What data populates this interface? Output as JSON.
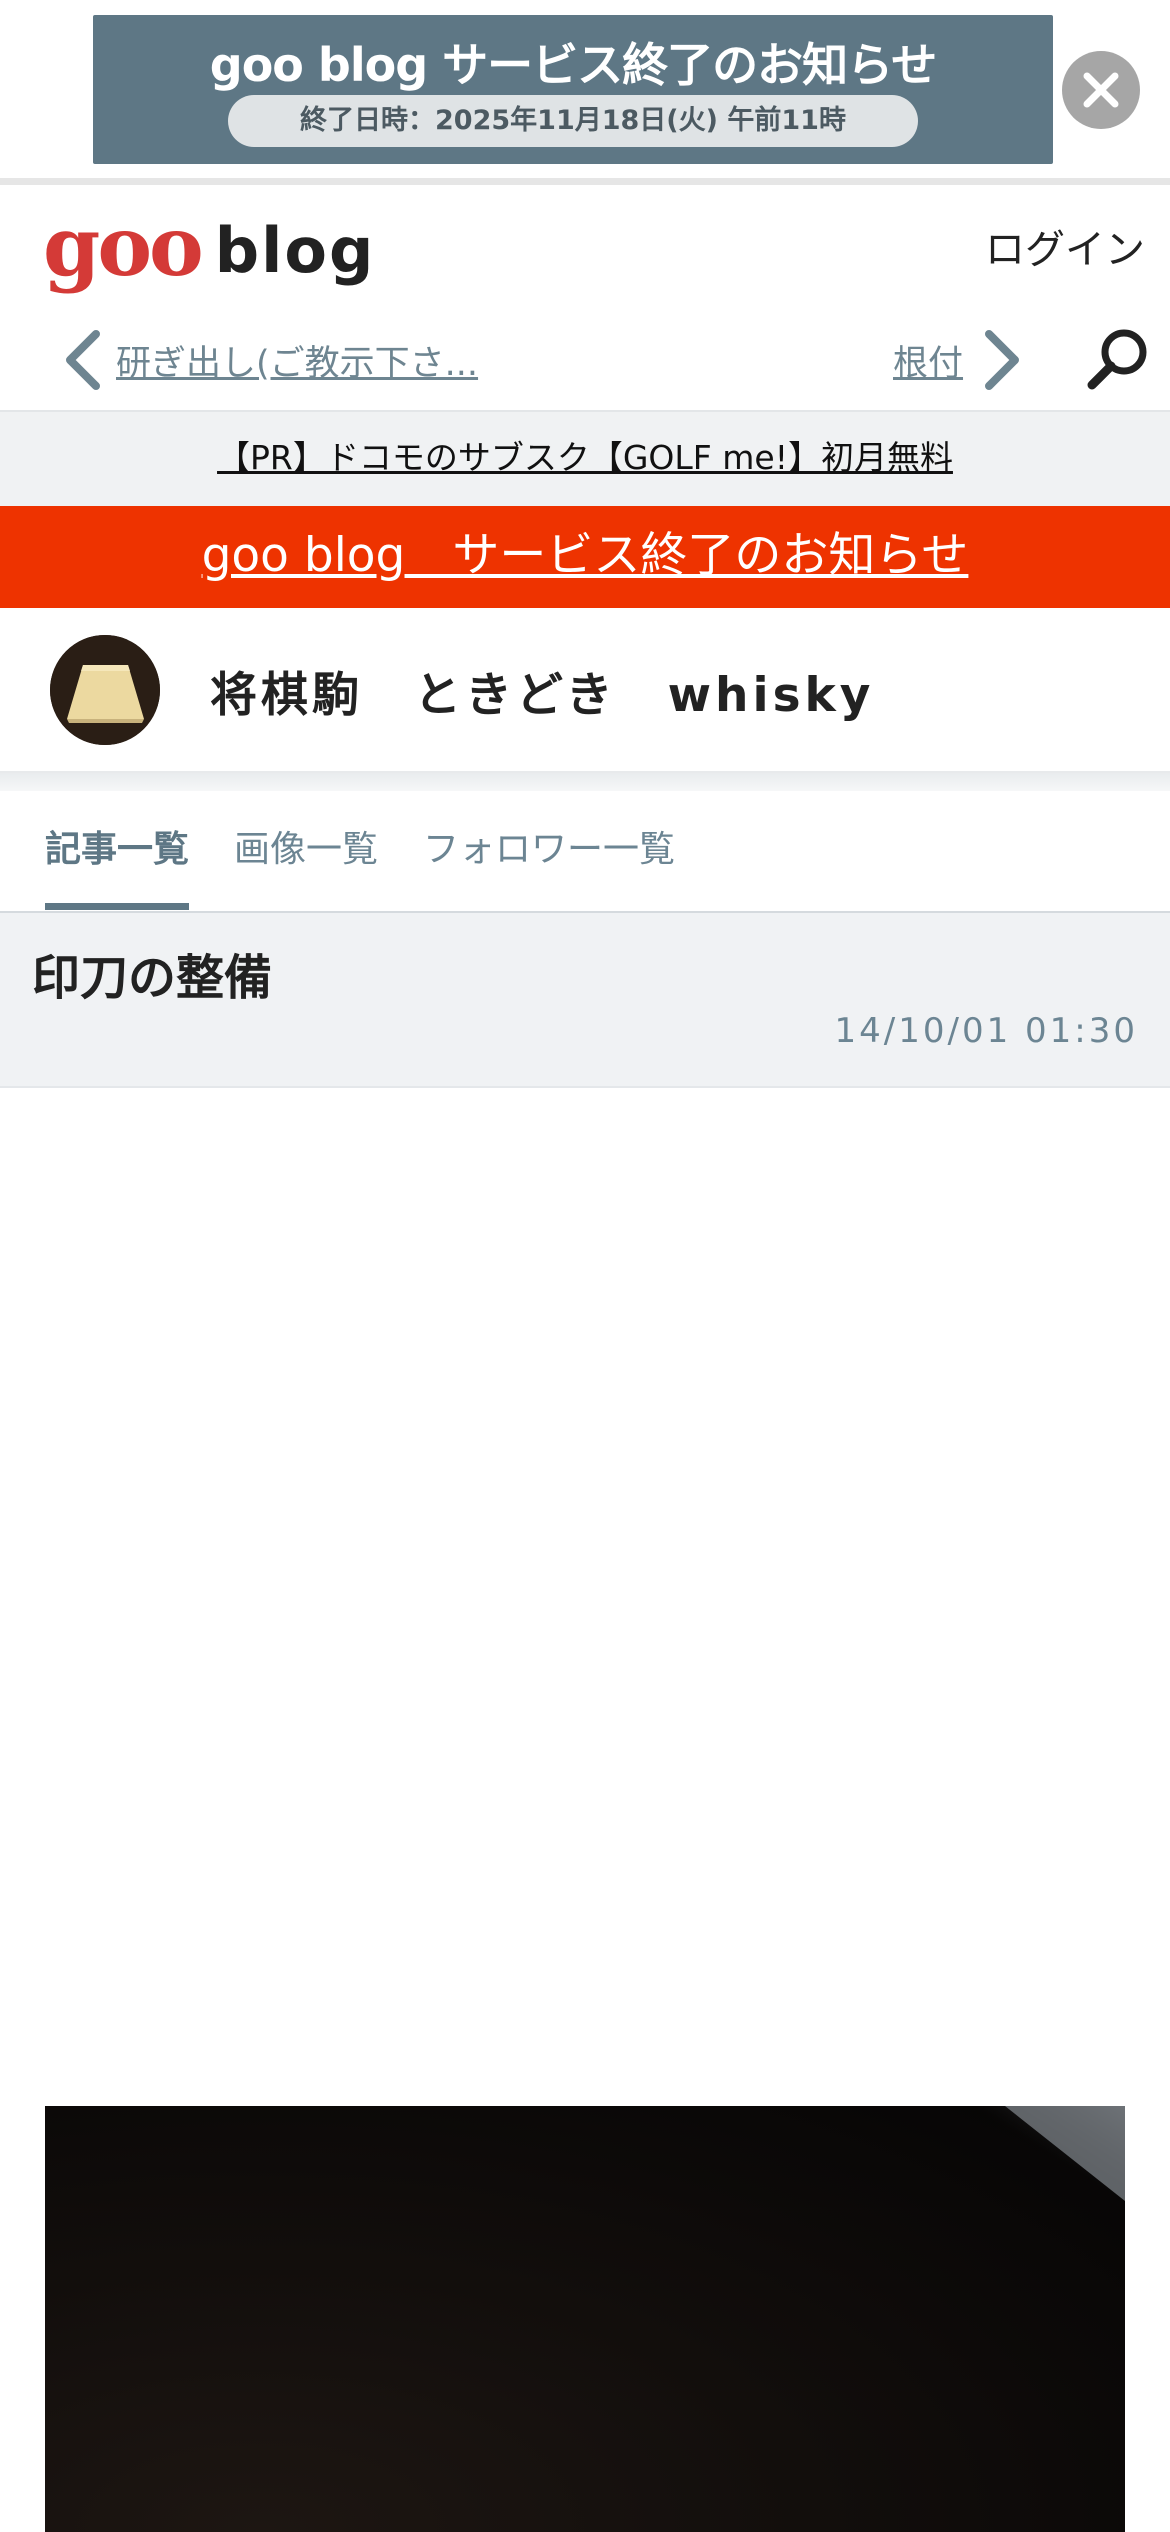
{
  "top_banner": {
    "title": "goo blog サービス終了のお知らせ",
    "subtitle": "終了日時：2025年11月18日(火) 午前11時",
    "close_icon": "close-icon"
  },
  "header": {
    "logo_goo": "goo",
    "logo_blog": "blog",
    "login_label": "ログイン"
  },
  "nav": {
    "prev_label": "研ぎ出し(ご教示下さ...",
    "next_label": "根付",
    "prev_icon": "chevron-left-icon",
    "next_icon": "chevron-right-icon",
    "search_icon": "search-icon"
  },
  "pr_link": "【PR】ドコモのサブスク【GOLF me!】初月無料",
  "service_notice": "goo blog　サービス終了のお知らせ",
  "blog": {
    "title": "将棋駒　ときどき　whisky"
  },
  "tabs": [
    {
      "label": "記事一覧",
      "active": true
    },
    {
      "label": "画像一覧",
      "active": false
    },
    {
      "label": "フォロワー一覧",
      "active": false
    }
  ],
  "article": {
    "title": "印刀の整備",
    "date": "14/10/01 01:30"
  },
  "colors": {
    "brand_red": "#d43a37",
    "notice_red": "#ee3300",
    "accent_slate": "#5e7785"
  }
}
